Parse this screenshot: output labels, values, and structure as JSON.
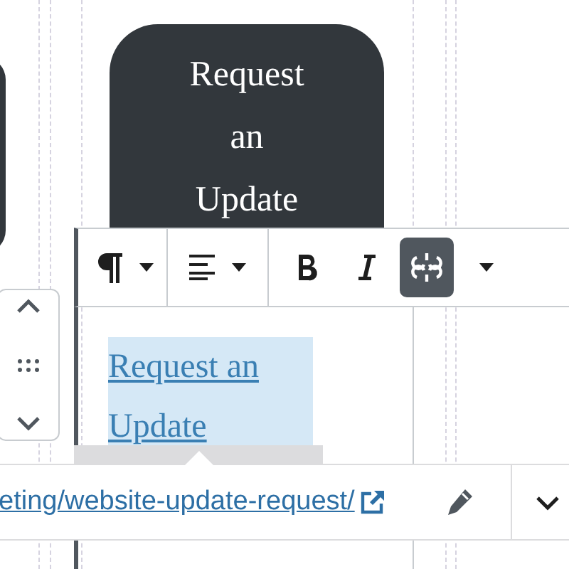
{
  "button_block": {
    "text": "Request an Update"
  },
  "toolbar": {
    "formats": [
      {
        "kind": "bold",
        "pressed": false
      },
      {
        "kind": "italic",
        "pressed": false
      },
      {
        "kind": "link",
        "pressed": true
      }
    ]
  },
  "paragraph": {
    "link_text": "Request an Update"
  },
  "link_popover": {
    "url": "eting/website-update-request/"
  }
}
